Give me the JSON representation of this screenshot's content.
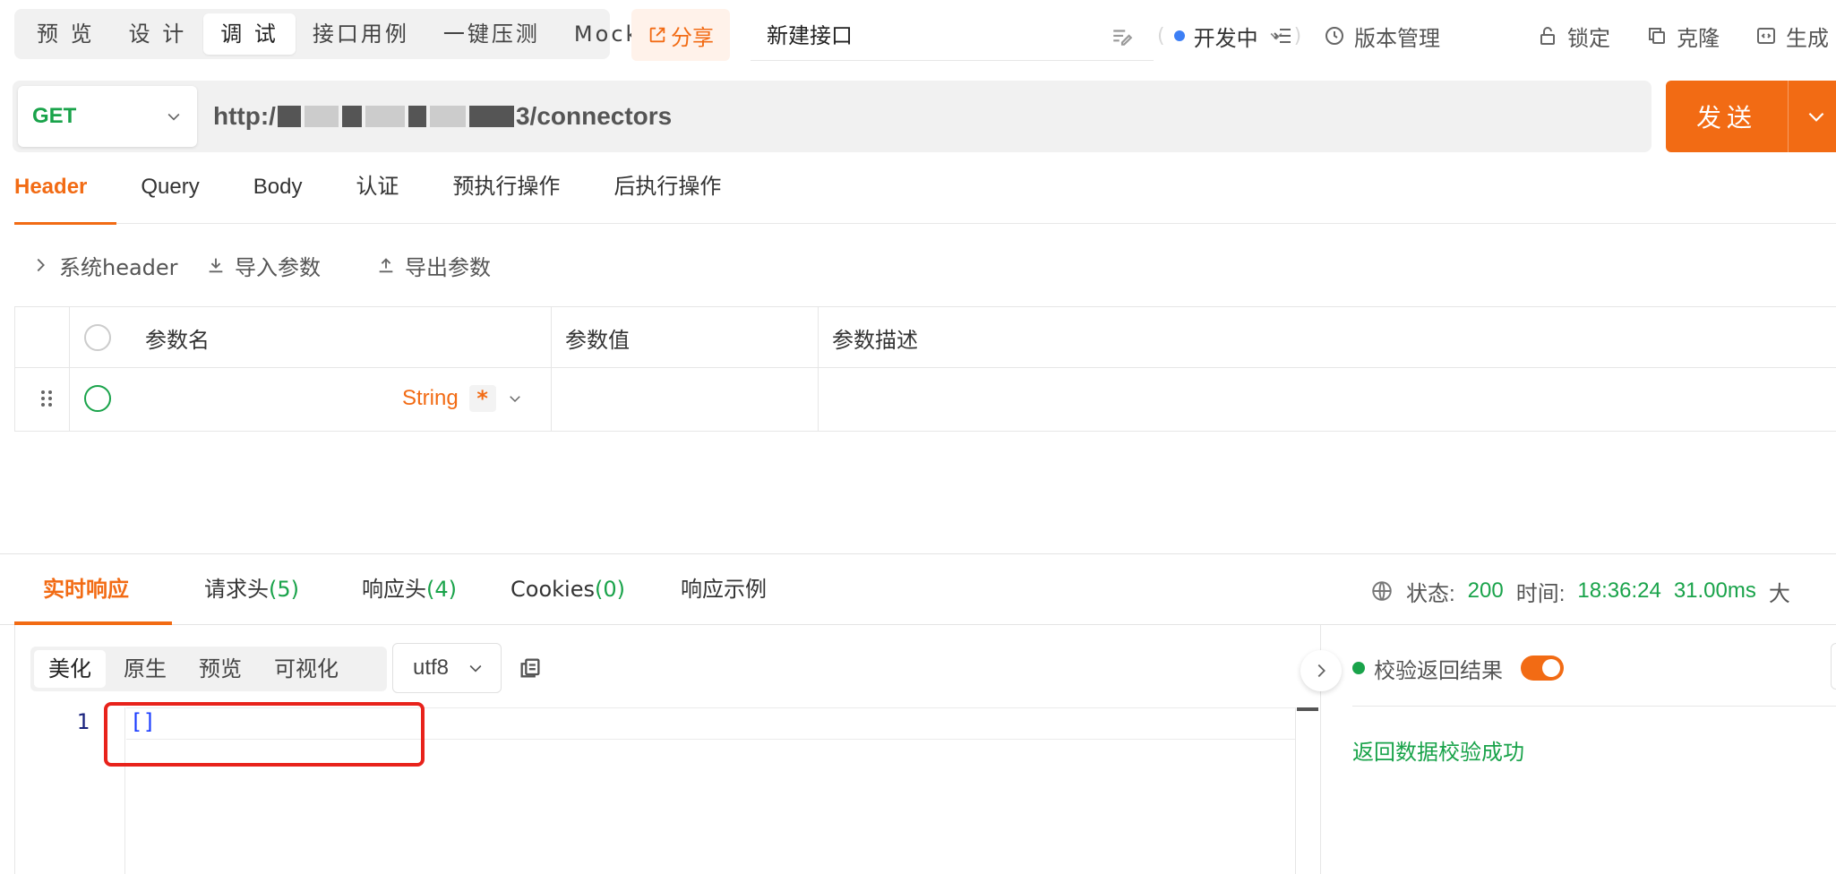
{
  "mode_tabs": [
    "预 览",
    "设 计",
    "调 试",
    "接口用例",
    "一键压测",
    "Mock"
  ],
  "active_mode": 2,
  "share_label": "分享",
  "api_name": "新建接口",
  "status_label": "开发中",
  "toolbar": {
    "version": "版本管理",
    "lock": "锁定",
    "clone": "克隆",
    "generate": "生成"
  },
  "request": {
    "method": "GET",
    "url_prefix": "http:/",
    "url_suffix": "3/connectors",
    "send_label": "发送"
  },
  "request_tabs": [
    "Header",
    "Query",
    "Body",
    "认证",
    "预执行操作",
    "后执行操作"
  ],
  "sub_tools": {
    "system_header": "系统header",
    "import": "导入参数",
    "export": "导出参数"
  },
  "param_table": {
    "headers": [
      "参数名",
      "参数值",
      "参数描述"
    ],
    "rows": [
      {
        "name": "",
        "type": "String",
        "required": "*",
        "value": "",
        "description": ""
      }
    ]
  },
  "response_tabs": [
    {
      "label": "实时响应",
      "count": ""
    },
    {
      "label": "请求头",
      "count": "(5)"
    },
    {
      "label": "响应头",
      "count": "(4)"
    },
    {
      "label": "Cookies",
      "count": "(0)"
    },
    {
      "label": "响应示例",
      "count": ""
    }
  ],
  "response_meta": {
    "status_label": "状态:",
    "status_value": "200",
    "time_label": "时间:",
    "time_value": "18:36:24",
    "duration": "31.00ms",
    "size_label": "大"
  },
  "format_tabs": [
    "美化",
    "原生",
    "预览",
    "可视化"
  ],
  "encoding": "utf8",
  "editor": {
    "line_number": "1",
    "code": "[]"
  },
  "validation": {
    "label": "校验返回结果",
    "enabled": true,
    "result": "返回数据校验成功"
  },
  "colors": {
    "accent": "#f26b14",
    "success": "#19a34a",
    "highlight_box": "#e8221b"
  }
}
